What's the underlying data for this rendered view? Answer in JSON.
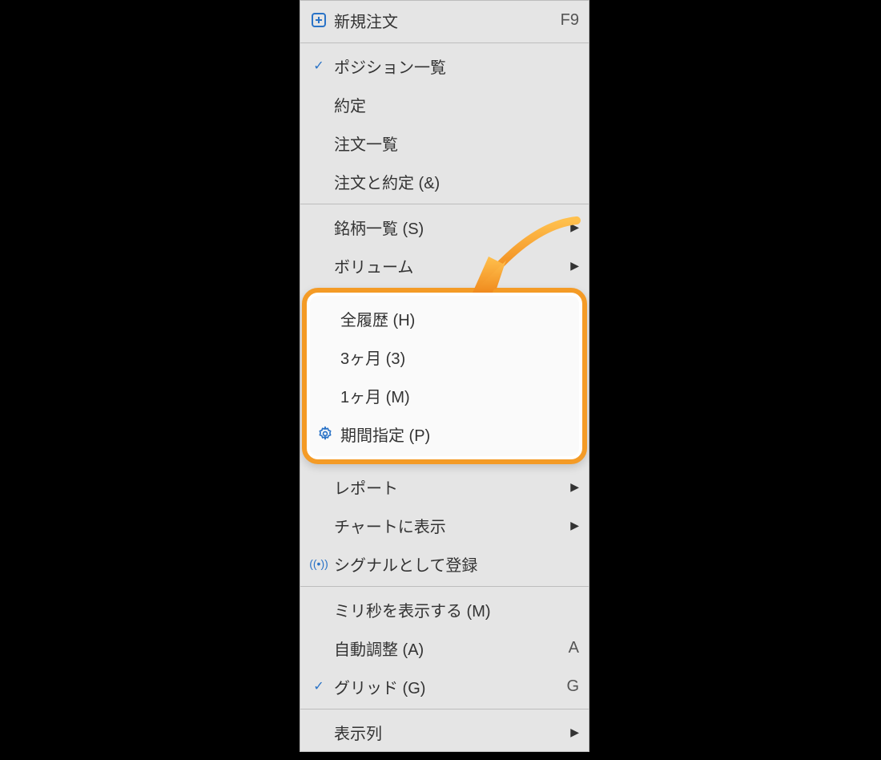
{
  "menu": {
    "new_order": {
      "label": "新規注文",
      "shortcut": "F9"
    },
    "group_view": {
      "positions": "ポジション一覧",
      "executions": "約定",
      "orders": "注文一覧",
      "orders_and_executions": "注文と約定 (&)"
    },
    "group_symbols": {
      "symbol_list": "銘柄一覧 (S)",
      "volume": "ボリューム"
    },
    "history_group": {
      "all_history": "全履歴 (H)",
      "three_months": "3ヶ月 (3)",
      "one_month": "1ヶ月 (M)",
      "custom_range": "期間指定 (P)"
    },
    "group_report": {
      "report": "レポート",
      "show_on_chart": "チャートに表示",
      "register_signal": "シグナルとして登録"
    },
    "group_display": {
      "show_ms": "ミリ秒を表示する (M)",
      "auto_adjust": {
        "label": "自動調整 (A)",
        "shortcut": "A"
      },
      "grid": {
        "label": "グリッド (G)",
        "shortcut": "G"
      }
    },
    "columns": "表示列"
  }
}
